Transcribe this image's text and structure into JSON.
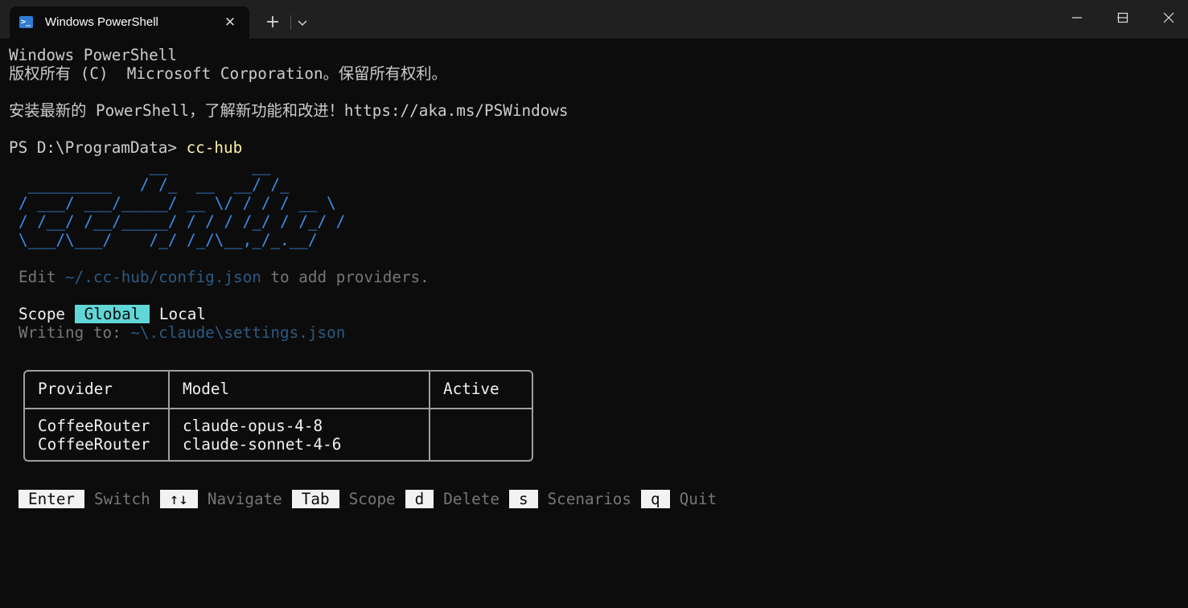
{
  "window": {
    "tab_title": "Windows PowerShell",
    "icons": [
      "powershell-icon",
      "close-icon",
      "plus-icon",
      "chevron-down-icon",
      "minimize-icon",
      "maximize-icon",
      "window-close-icon"
    ]
  },
  "terminal": {
    "banner_line1": "Windows PowerShell",
    "banner_line2": "版权所有 (C)  Microsoft Corporation。保留所有权利。",
    "banner_line3": "安装最新的 PowerShell，了解新功能和改进！https://aka.ms/PSWindows",
    "prompt": "PS D:\\ProgramData> ",
    "command": "cc-hub",
    "logo_lines": [
      "              __         __",
      " _________   / /_  __  __/ /_",
      "/ ___/ ___/_____/ __ \\/ / / / __ \\",
      "/ /__/ /__/_____/ / / / /_/ / /_/ /",
      "\\___/\\___/    /_/ /_/\\__,_/_.__/"
    ],
    "hint_prefix": "Edit ",
    "hint_path": "~/.cc-hub/config.json",
    "hint_suffix": " to add providers.",
    "scope_label": "Scope ",
    "scope_global": "Global",
    "scope_local": " Local",
    "writing_label": "Writing to: ",
    "writing_path": "~\\.claude\\settings.json",
    "table": {
      "headers": [
        "Provider",
        "Model",
        "Active"
      ],
      "rows": [
        {
          "provider": "CoffeeRouter",
          "model": "claude-opus-4-8",
          "active": ""
        },
        {
          "provider": "CoffeeRouter",
          "model": "claude-sonnet-4-6",
          "active": ""
        }
      ]
    },
    "keybinds": [
      {
        "key": "Enter",
        "desc": "Switch"
      },
      {
        "key": "↑↓",
        "desc": "Navigate"
      },
      {
        "key": "Tab",
        "desc": "Scope"
      },
      {
        "key": "d",
        "desc": "Delete"
      },
      {
        "key": "s",
        "desc": "Scenarios"
      },
      {
        "key": "q",
        "desc": "Quit"
      }
    ]
  },
  "colors": {
    "background": "#0c0c0c",
    "titlebar": "#202020",
    "logo_blue": "#3b8eea",
    "selected_green": "#16c60c",
    "scope_highlight": "#61d6d6",
    "command_yellow": "#f9f1a5"
  }
}
